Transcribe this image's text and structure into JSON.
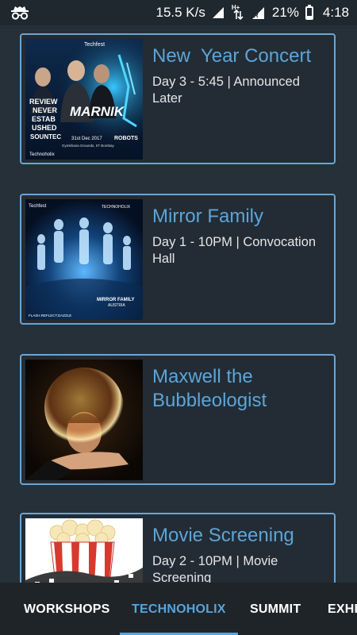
{
  "status_bar": {
    "network_speed": "15.5 K/s",
    "network_type_badge": "H+",
    "roaming_badge": "R",
    "battery_percent": "21%",
    "battery_level": 0.21,
    "time": "4:18",
    "icons": [
      "incognito-icon",
      "signal-icon",
      "data-arrows-icon",
      "signal-roaming-icon",
      "battery-icon"
    ]
  },
  "events": [
    {
      "title": "New  Year Concert",
      "subtitle": "Day 3 - 5:45 | Announced Later",
      "poster": {
        "brand": "Techfest",
        "headliner": "MARNIK",
        "side_text": [
          "REVIEW",
          "NEVER",
          "ESTAB",
          "USHED"
        ],
        "support_left": "SOUNTEC",
        "support_right": "ROBOTS",
        "date_line": "31st Dec 2017",
        "venue_line": "Gymkhana Grounds, IIT Bombay",
        "footer": "Technoholix"
      }
    },
    {
      "title": "Mirror Family",
      "subtitle": "Day 1 - 10PM | Convocation Hall",
      "poster": {
        "brand": "Techfest",
        "top_right": "TECHNOHOLIX",
        "name": "MIRROR FAMILY",
        "country": "AUSTRIA",
        "tagline": "FLASH.REFLECT.DAZZLE"
      }
    },
    {
      "title": "Maxwell the Bubbleologist",
      "subtitle": "",
      "poster": {}
    },
    {
      "title": "Movie Screening",
      "subtitle": "Day 2 - 10PM | Movie Screening",
      "poster": {}
    }
  ],
  "tabs": [
    {
      "label": "WORKSHOPS",
      "active": false
    },
    {
      "label": "TECHNOHOLIX",
      "active": true
    },
    {
      "label": "SUMMIT",
      "active": false
    },
    {
      "label": "EXHI",
      "active": false
    }
  ],
  "colors": {
    "accent": "#56a5dc",
    "card_border": "#6aa5d6",
    "background": "#263039",
    "tab_bar": "#1f2429"
  }
}
